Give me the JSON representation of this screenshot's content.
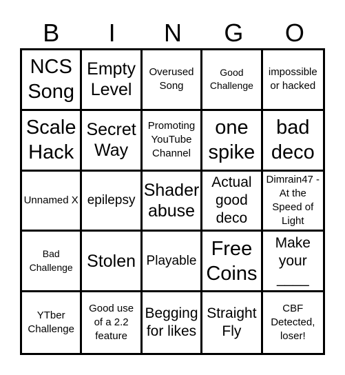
{
  "header": {
    "letters": [
      "B",
      "I",
      "N",
      "G",
      "O"
    ]
  },
  "cells": [
    {
      "text": "NCS Song",
      "size": "s-xl"
    },
    {
      "text": "Empty Level",
      "size": "s-l"
    },
    {
      "text": "Overused Song",
      "size": "s-s"
    },
    {
      "text": "Good Challenge",
      "size": "s-xs"
    },
    {
      "text": "impossible or hacked",
      "size": "s-s"
    },
    {
      "text": "Scale Hack",
      "size": "s-xl"
    },
    {
      "text": "Secret Way",
      "size": "s-l"
    },
    {
      "text": "Promoting YouTube Channel",
      "size": "s-s"
    },
    {
      "text": "one spike",
      "size": "s-xl"
    },
    {
      "text": "bad deco",
      "size": "s-xl"
    },
    {
      "text": "Unnamed X",
      "size": "s-s"
    },
    {
      "text": "epilepsy",
      "size": "s-m"
    },
    {
      "text": "Shader abuse",
      "size": "s-l"
    },
    {
      "text": "Actual good deco",
      "size": "s-ml"
    },
    {
      "text": "Dimrain47 - At the Speed of Light",
      "size": "s-s"
    },
    {
      "text": "Bad Challenge",
      "size": "s-xs"
    },
    {
      "text": "Stolen",
      "size": "s-l"
    },
    {
      "text": "Playable",
      "size": "s-m"
    },
    {
      "text": "Free Coins",
      "size": "s-xl"
    },
    {
      "text": "Make your ____",
      "size": "s-ml"
    },
    {
      "text": "YTber Challenge",
      "size": "s-s"
    },
    {
      "text": "Good use of a 2.2 feature",
      "size": "s-s"
    },
    {
      "text": "Begging for likes",
      "size": "s-ml"
    },
    {
      "text": "Straight Fly",
      "size": "s-ml"
    },
    {
      "text": "CBF Detected, loser!",
      "size": "s-s"
    }
  ]
}
